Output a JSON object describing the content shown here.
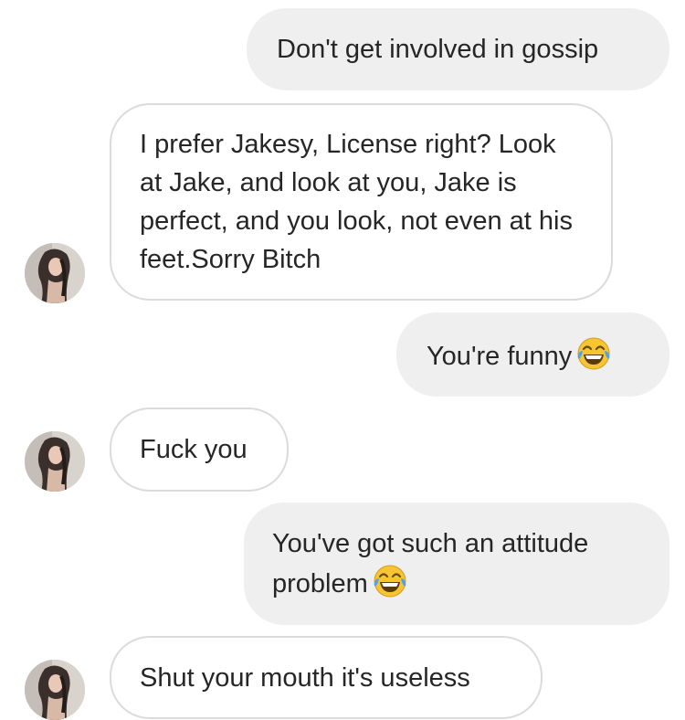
{
  "messages": [
    {
      "sender": "me",
      "text": "Don't get involved in gossip"
    },
    {
      "sender": "them",
      "text": "I prefer Jakesy, License right? Look at Jake, and look at you, Jake is perfect, and you look, not even at his feet.Sorry Bitch"
    },
    {
      "sender": "me",
      "text": "You're funny",
      "emoji": "tears-of-joy"
    },
    {
      "sender": "them",
      "text": "Fuck you"
    },
    {
      "sender": "me",
      "text": "You've got such an attitude problem",
      "emoji": "tears-of-joy"
    },
    {
      "sender": "them",
      "text": "Shut your mouth it's useless"
    }
  ],
  "colors": {
    "outgoing_bubble": "#efefef",
    "incoming_border": "#dbdbdb",
    "text": "#262626"
  }
}
